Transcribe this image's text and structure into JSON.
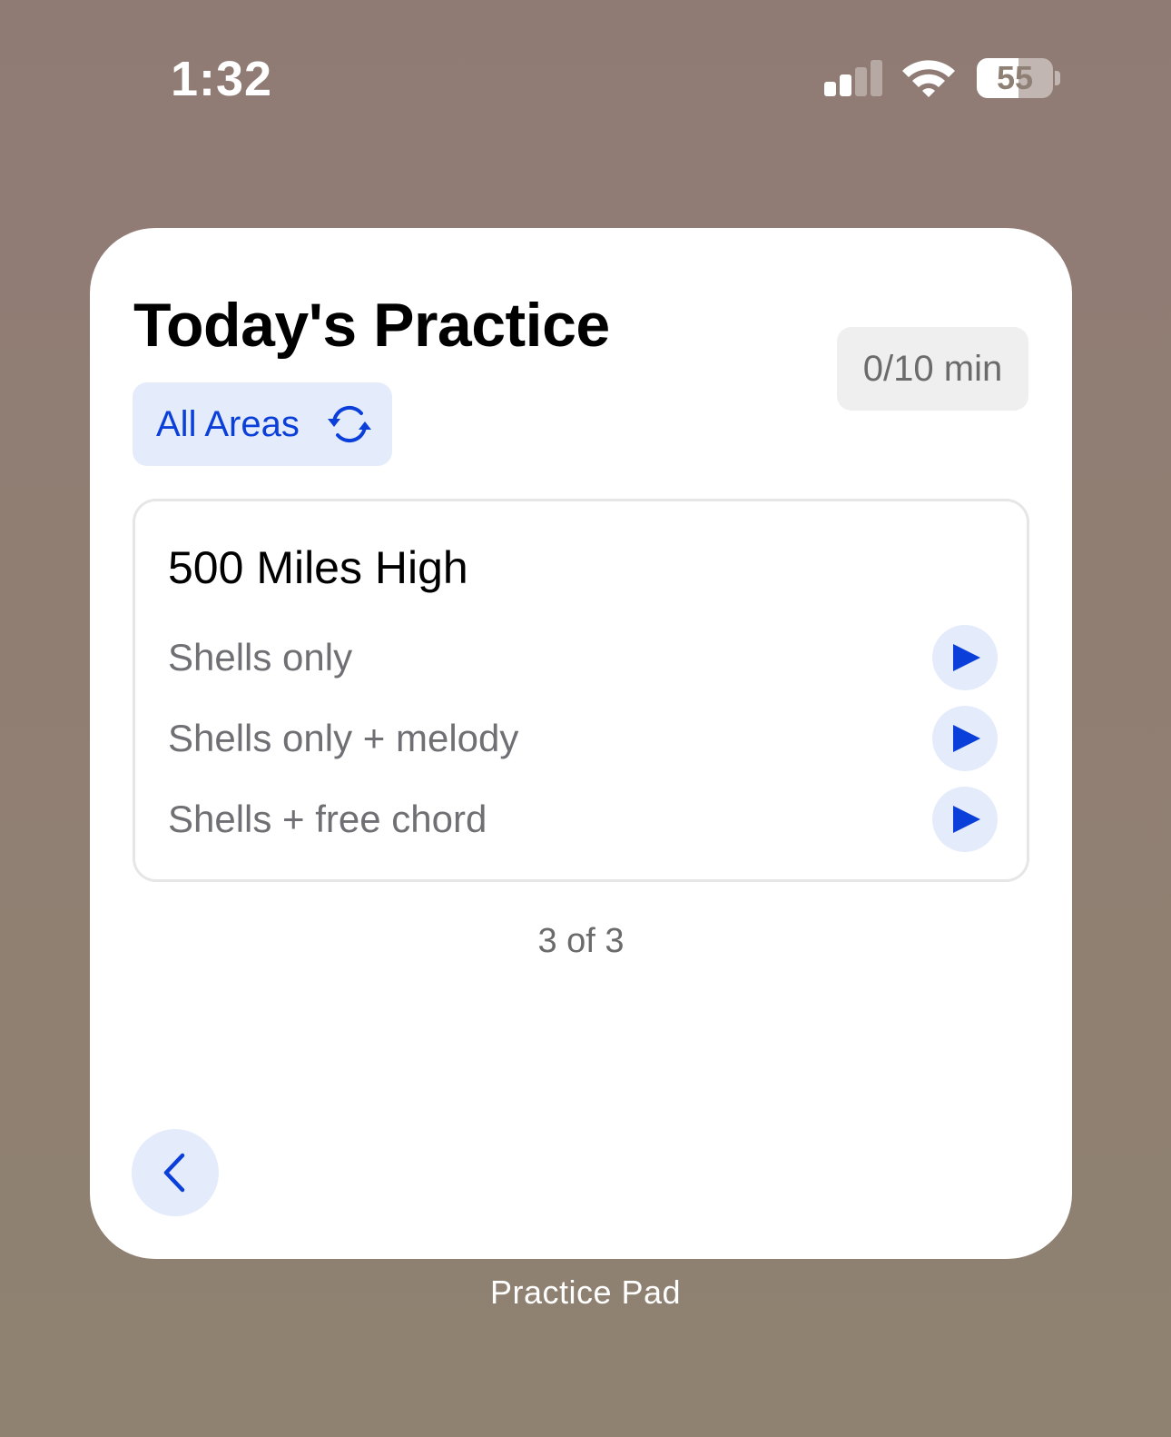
{
  "status_bar": {
    "time": "1:32",
    "battery_level": "55",
    "battery_fraction": 0.55,
    "signal_bars_active": 2,
    "signal_bars_total": 4
  },
  "widget": {
    "title": "Today's Practice",
    "area_filter": {
      "label": "All Areas",
      "icon": "refresh-icon"
    },
    "time_badge": "0/10 min",
    "card": {
      "title": "500 Miles High",
      "exercises": [
        {
          "label": "Shells only",
          "action_icon": "play-icon"
        },
        {
          "label": "Shells only + melody",
          "action_icon": "play-icon"
        },
        {
          "label": "Shells + free chord",
          "action_icon": "play-icon"
        }
      ]
    },
    "page_indicator": "3 of 3",
    "back_icon": "chevron-left-icon"
  },
  "caption": "Practice Pad",
  "colors": {
    "accent": "#0b3fd9",
    "accent_background": "#e4ecfb",
    "secondary_text": "#6f6f74",
    "wallpaper_top": "#907b74",
    "wallpaper_bottom": "#8f8271"
  }
}
